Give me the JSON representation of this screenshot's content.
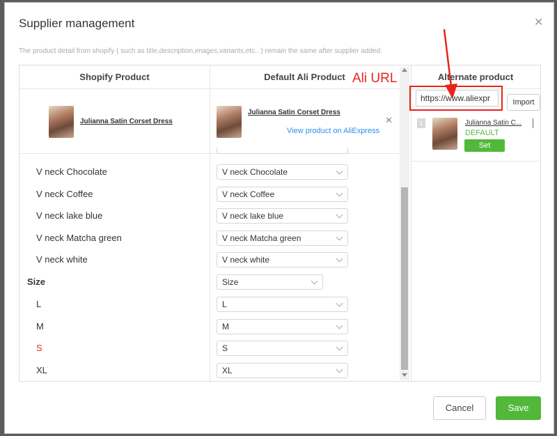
{
  "modal": {
    "title": "Supplier management",
    "note": "The product detail from shopify ( such as title,description,images,variants,etc.. ) remain the same after supplier added."
  },
  "columns": {
    "shopify": "Shopify Product",
    "ali": "Default Ali Product",
    "alternate": "Alternate product"
  },
  "product": {
    "name": "Julianna Satin Corset Dress",
    "view_link": "View product on AliExpress",
    "alt_name": "Julianna Satin C..."
  },
  "annotation": {
    "label": "Ali URL",
    "color": "#e8231c"
  },
  "alternate": {
    "url_value": "https://www.aliexpr",
    "import_label": "Import",
    "index": "1",
    "default_tag": "DEFAULT",
    "set_label": "Set"
  },
  "variants": [
    {
      "label": "V neck Chocolate",
      "value": "V neck Chocolate"
    },
    {
      "label": "V neck Coffee",
      "value": "V neck Coffee"
    },
    {
      "label": "V neck lake blue",
      "value": "V neck lake blue"
    },
    {
      "label": "V neck Matcha green",
      "value": "V neck Matcha green"
    },
    {
      "label": "V neck white",
      "value": "V neck white"
    }
  ],
  "size_group": {
    "label": "Size",
    "value": "Size"
  },
  "sizes": [
    {
      "label": "L",
      "value": "L"
    },
    {
      "label": "M",
      "value": "M"
    },
    {
      "label": "S",
      "value": "S"
    },
    {
      "label": "XL",
      "value": "XL"
    }
  ],
  "footer": {
    "cancel": "Cancel",
    "save": "Save"
  },
  "colors": {
    "accent": "#52b83a",
    "highlight": "#d9381e"
  }
}
